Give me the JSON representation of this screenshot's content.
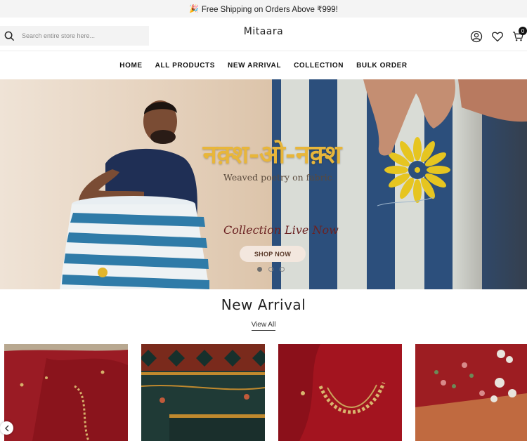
{
  "announcement": {
    "icon": "party-popper-icon",
    "text": "Free Shipping on Orders Above ₹999!"
  },
  "header": {
    "search_placeholder": "Search entire store here...",
    "logo": "Mitaara",
    "cart_count": "0",
    "icons": [
      "search-icon",
      "account-icon",
      "wishlist-heart-icon",
      "cart-icon"
    ]
  },
  "nav": {
    "items": [
      "HOME",
      "ALL PRODUCTS",
      "NEW ARRIVAL",
      "COLLECTION",
      "BULK ORDER"
    ]
  },
  "hero": {
    "title": "नक़्श-ओ-नक़्श",
    "subtitle": "Weaved poetry on fabric",
    "tagline": "Collection Live Now",
    "button": "SHOP NOW",
    "slides": 3,
    "active_slide": 1
  },
  "new_arrival": {
    "title": "New Arrival",
    "view_all": "View All"
  },
  "colors": {
    "accent": "#e8b63a",
    "hero_blue": "#2c4f7c",
    "maroon": "#8f1620"
  }
}
